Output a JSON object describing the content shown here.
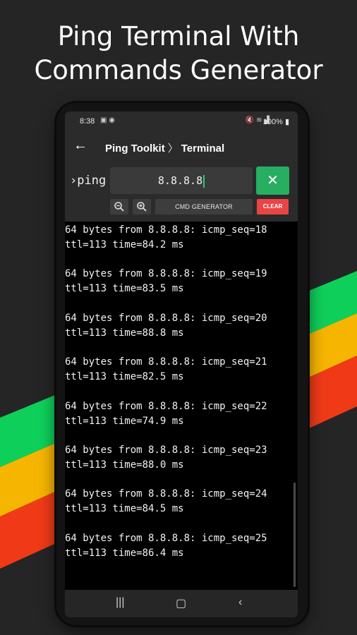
{
  "promo": {
    "headline_line1": "Ping Terminal With",
    "headline_line2": "Commands Generator"
  },
  "colors": {
    "background": "#252525",
    "stripe_green": "#0fcf5b",
    "stripe_yellow": "#f6b500",
    "stripe_red": "#f03a17",
    "go_button": "#27ae60",
    "clear_button": "#ea4545"
  },
  "status_bar": {
    "time": "8:38",
    "battery": "100%"
  },
  "app_bar": {
    "breadcrumb_root": "Ping Toolkit",
    "breadcrumb_separator": "〉",
    "breadcrumb_current": "Terminal"
  },
  "input_bar": {
    "prompt": "›ping",
    "command_value": "8.8.8.8",
    "go_icon": "close-icon",
    "generator_label": "CMD GENERATOR",
    "clear_label": "CLEAR"
  },
  "terminal": {
    "lines": [
      "64 bytes from 8.8.8.8: icmp_seq=18",
      "ttl=113 time=84.2 ms",
      "64 bytes from 8.8.8.8: icmp_seq=19",
      "ttl=113 time=83.5 ms",
      "64 bytes from 8.8.8.8: icmp_seq=20",
      "ttl=113 time=88.8 ms",
      "64 bytes from 8.8.8.8: icmp_seq=21",
      "ttl=113 time=82.5 ms",
      "64 bytes from 8.8.8.8: icmp_seq=22",
      "ttl=113 time=74.9 ms",
      "64 bytes from 8.8.8.8: icmp_seq=23",
      "ttl=113 time=88.0 ms",
      "64 bytes from 8.8.8.8: icmp_seq=24",
      "ttl=113 time=84.5 ms",
      "64 bytes from 8.8.8.8: icmp_seq=25",
      "ttl=113 time=86.4 ms"
    ]
  },
  "nav_bar": {
    "recents_icon": "recents-icon",
    "home_icon": "home-icon",
    "back_icon": "back-chevron-icon"
  }
}
